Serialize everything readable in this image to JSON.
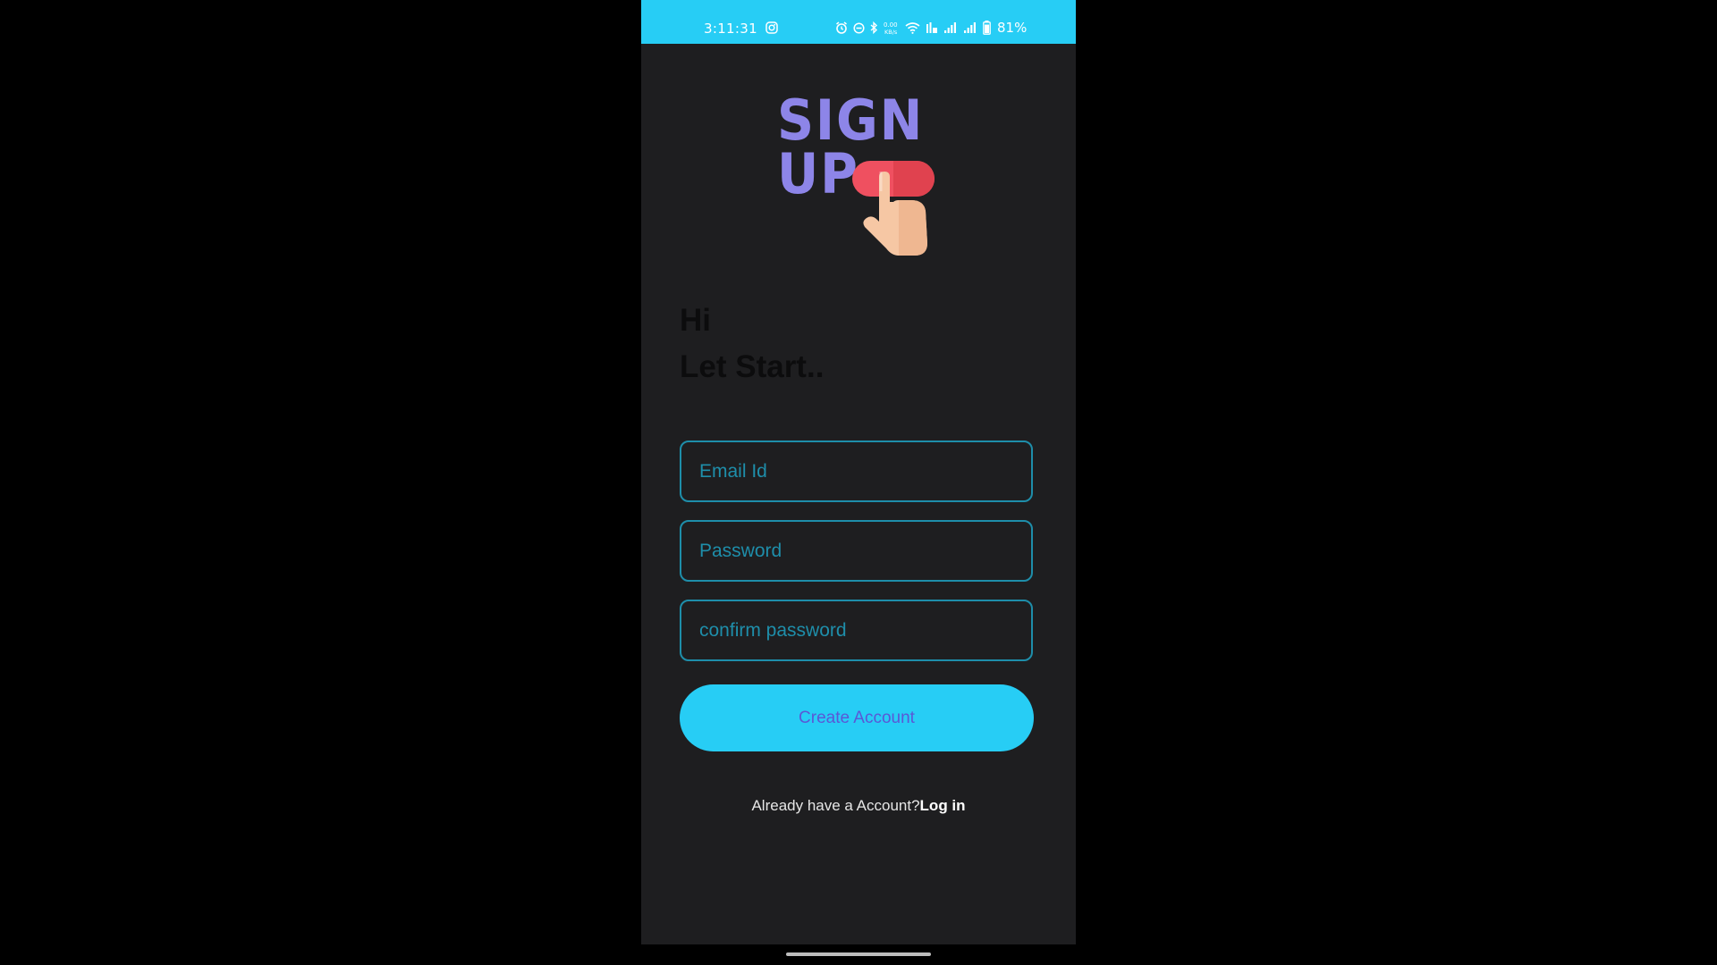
{
  "status_bar": {
    "time": "3:11:31",
    "battery": "81%",
    "icons": [
      "instagram-icon",
      "alarm-icon",
      "dnd-icon",
      "bluetooth-icon",
      "data-speed-icon",
      "wifi-icon",
      "volte-icon",
      "signal-icon",
      "signal-icon-2",
      "battery-icon"
    ],
    "data_speed": "0.00"
  },
  "logo": {
    "line1": "SIGN",
    "line2": "UP"
  },
  "greeting": {
    "line1": "Hi",
    "line2": "Let Start.."
  },
  "form": {
    "email_placeholder": "Email Id",
    "password_placeholder": "Password",
    "confirm_placeholder": "confirm password",
    "submit_label": "Create Account"
  },
  "footer": {
    "prompt": "Already have a Account?",
    "login_label": "Log in"
  },
  "colors": {
    "accent": "#27cdf5",
    "background": "#1e1e20",
    "logo_text": "#8d85e8",
    "field_border": "#1e8eaa",
    "button_text": "#5a58d6"
  }
}
